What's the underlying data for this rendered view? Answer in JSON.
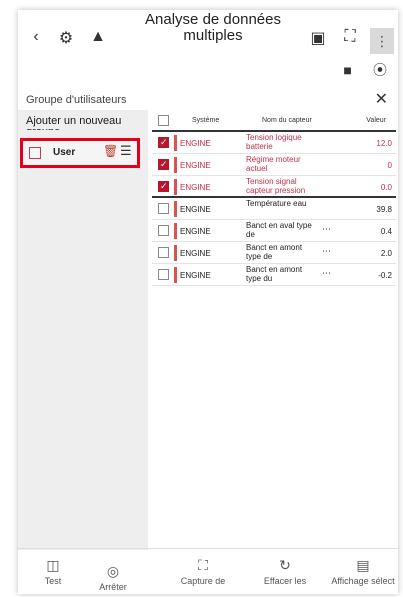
{
  "header": {
    "title_line1": "Analyse de données",
    "title_line2": "multiples",
    "back_icon": "chevron-left-icon",
    "icons": [
      "vehicle-gear-icon",
      "battery-upload-icon",
      "vehicle-scan-icon",
      "fullscreen-icon",
      "more-icon"
    ],
    "sub_icons": [
      "vehicle-settings-icon",
      "chart-settings-icon"
    ]
  },
  "group": {
    "label": "Groupe d'utilisateurs",
    "close_icon": "close-icon"
  },
  "sidebar": {
    "add_label": "Ajouter un nouveau groupe",
    "user_item": {
      "name": "User"
    }
  },
  "table": {
    "headers": {
      "system": "Système",
      "sensor": "Nom du capteur",
      "value": "Valeur"
    },
    "rows": [
      {
        "system": "ENGINE",
        "name": "Tension logique batterie",
        "value": "12.0",
        "selected": true,
        "dots": false
      },
      {
        "system": "ENGINE",
        "name": "Régime moteur actuel",
        "value": "0",
        "selected": true,
        "dots": false
      },
      {
        "system": "ENGINE",
        "name": "Tension signal capteur pression",
        "value": "0.0",
        "selected": true,
        "dots": false
      },
      {
        "system": "ENGINE",
        "name": "Température eau",
        "value": "39.8",
        "selected": false,
        "dots": false
      },
      {
        "system": "ENGINE",
        "name": "Banct en aval type de",
        "value": "0.4",
        "selected": false,
        "dots": true
      },
      {
        "system": "ENGINE",
        "name": "Banct en amont type de",
        "value": "2.0",
        "selected": false,
        "dots": true
      },
      {
        "system": "ENGINE",
        "name": "Banct en amont type du",
        "value": "-0.2",
        "selected": false,
        "dots": true
      }
    ]
  },
  "bottom": {
    "test": "Test",
    "stop": "Arrêter",
    "capture": "Capture de",
    "clear": "Effacer les",
    "display": "Affichage sélect"
  }
}
